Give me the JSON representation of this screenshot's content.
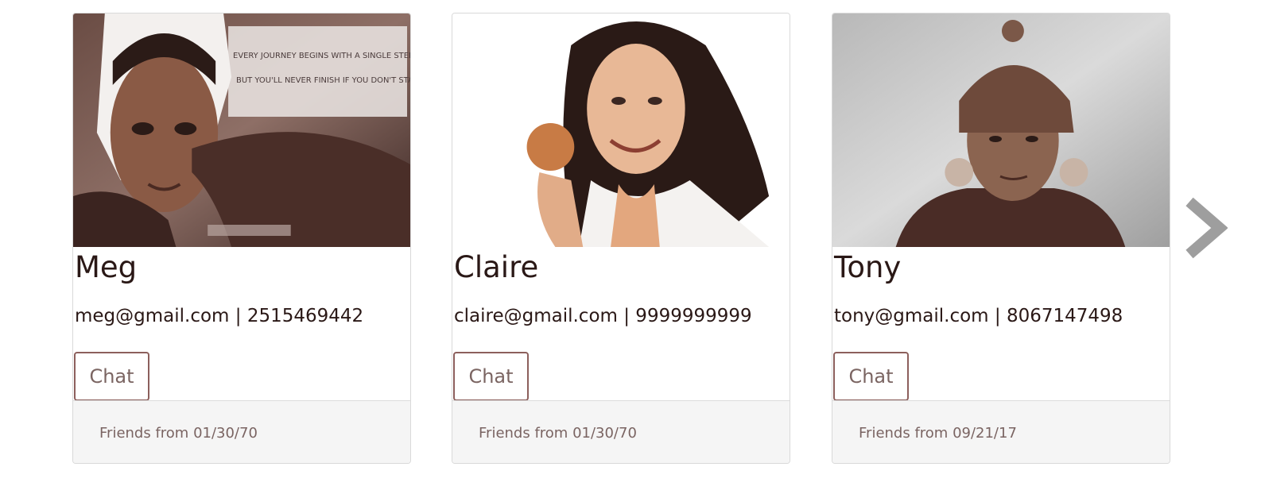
{
  "friends": [
    {
      "name": "Meg",
      "contact": "meg@gmail.com | 2515469442",
      "chat_label": "Chat",
      "friends_since": "Friends from 01/30/70",
      "photo_caption_1": "EVERY JOURNEY BEGINS WITH A SINGLE STEP.",
      "photo_caption_2": "BUT YOU'LL NEVER FINISH IF YOU DON'T START."
    },
    {
      "name": "Claire",
      "contact": "claire@gmail.com | 9999999999",
      "chat_label": "Chat",
      "friends_since": "Friends from 01/30/70"
    },
    {
      "name": "Tony",
      "contact": "tony@gmail.com | 8067147498",
      "chat_label": "Chat",
      "friends_since": "Friends from 09/21/17"
    }
  ],
  "navigation": {
    "next_icon": "chevron-right-icon"
  },
  "colors": {
    "text": "#2a1816",
    "button_border": "#8c5f5c",
    "footer_bg": "#f5f5f5",
    "arrow": "#9e9e9e"
  }
}
